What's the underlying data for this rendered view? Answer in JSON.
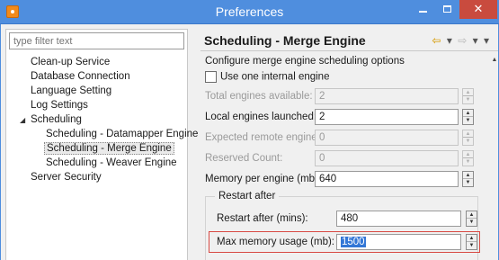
{
  "window": {
    "title": "Preferences",
    "min_glyph": "",
    "max_glyph": "",
    "close_glyph": "✕"
  },
  "filter": {
    "placeholder": "type filter text"
  },
  "tree": {
    "items": [
      {
        "label": "Clean-up Service"
      },
      {
        "label": "Database Connection"
      },
      {
        "label": "Language Setting"
      },
      {
        "label": "Log Settings"
      },
      {
        "label": "Scheduling"
      },
      {
        "label": "Scheduling - Datamapper Engine"
      },
      {
        "label": "Scheduling - Merge Engine"
      },
      {
        "label": "Scheduling - Weaver Engine"
      },
      {
        "label": "Server Security"
      }
    ],
    "expander_glyph": "◢"
  },
  "page": {
    "title": "Scheduling - Merge Engine",
    "nav": {
      "back": "⇦",
      "back_menu": "▾",
      "forward": "⇨",
      "forward_menu": "▾",
      "view_menu": "▾"
    },
    "description": "Configure merge engine scheduling options",
    "checkbox_label": "Use one internal engine",
    "fields": [
      {
        "label": "Total engines available:",
        "value": "2"
      },
      {
        "label": "Local engines launched:",
        "value": "2"
      },
      {
        "label": "Expected remote engines:",
        "value": "0"
      },
      {
        "label": "Reserved Count:",
        "value": "0"
      },
      {
        "label": "Memory per engine (mb):",
        "value": "640"
      }
    ],
    "group": {
      "title": "Restart after",
      "fields": [
        {
          "label": "Restart after (mins):",
          "value": "480"
        },
        {
          "label": "Max memory usage (mb):",
          "value": "1500"
        }
      ]
    },
    "spinner_up": "▲",
    "spinner_down": "▼",
    "scroll_up": "▲"
  },
  "colors": {
    "titlebar": "#4f8ede",
    "close": "#c94b3e",
    "highlight_border": "#d84a44",
    "selection": "#3377d6"
  }
}
